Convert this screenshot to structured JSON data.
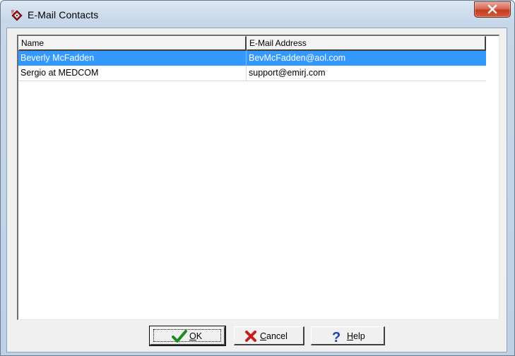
{
  "window": {
    "title": "E-Mail Contacts",
    "icon": "email-contacts-app-icon"
  },
  "columns": [
    "Name",
    "E-Mail Address"
  ],
  "contacts": [
    {
      "name": "Beverly McFadden",
      "email": "BevMcFadden@aol.com",
      "selected": true
    },
    {
      "name": "Sergio at MEDCOM",
      "email": "support@emirj.com",
      "selected": false
    }
  ],
  "buttons": {
    "ok": {
      "pre": "",
      "mnemonic": "O",
      "post": "K",
      "icon": "checkmark-icon"
    },
    "cancel": {
      "pre": "",
      "mnemonic": "C",
      "post": "ancel",
      "icon": "red-x-icon"
    },
    "help": {
      "pre": "",
      "mnemonic": "H",
      "post": "elp",
      "icon": "question-mark-icon"
    }
  },
  "colors": {
    "selection": "#3399ff",
    "close_button": "#c53b20",
    "ok_check": "#1f8a1f",
    "cancel_x": "#c81e1e",
    "help_q": "#1d3fb8"
  }
}
